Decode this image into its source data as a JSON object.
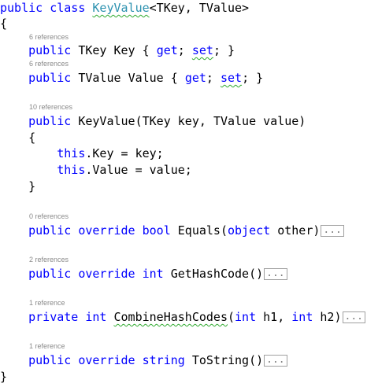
{
  "keywords": {
    "public": "public",
    "class": "class",
    "private": "private",
    "override": "override",
    "bool": "bool",
    "object": "object",
    "int": "int",
    "string": "string",
    "this": "this",
    "get": "get",
    "set": "set"
  },
  "class_decl": {
    "name": "KeyValue",
    "type_params": "<TKey, TValue>"
  },
  "braces": {
    "open": "{",
    "close": "}"
  },
  "lens": {
    "key_prop": "6 references",
    "value_prop": "6 references",
    "ctor": "10 references",
    "equals": "0 references",
    "gethashcode": "2 references",
    "combine": "1 reference",
    "tostring": "1 reference"
  },
  "members": {
    "key_prop": {
      "type": "TKey",
      "name": "Key"
    },
    "value_prop": {
      "type": "TValue",
      "name": "Value"
    },
    "ctor": {
      "name": "KeyValue(",
      "p1_type": "TKey",
      "p1_name": "key",
      "p2_type": "TValue",
      "p2_name": "value)"
    },
    "ctor_body": {
      "line1": ".Key = key;",
      "line2": ".Value = value;"
    },
    "equals": {
      "name": "Equals(",
      "param_name": "other)"
    },
    "gethashcode": {
      "name": "GetHashCode()"
    },
    "combine": {
      "name": "CombineHashCodes",
      "paren_open": "(",
      "p1_name": "h1,",
      "p2_name": "h2)"
    },
    "tostring": {
      "name": "ToString()"
    }
  },
  "collapsed_label": "...",
  "colors": {
    "keyword": "#0000ff",
    "type_name": "#2b91af",
    "codelens": "#8a8a8a",
    "squiggle": "#2eaa2e"
  }
}
